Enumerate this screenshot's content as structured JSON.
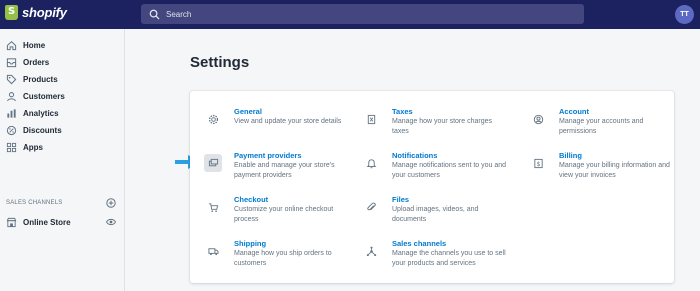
{
  "topbar": {
    "brand": "shopify",
    "search_placeholder": "Search",
    "avatar_initials": "TT"
  },
  "sidebar": {
    "items": [
      {
        "label": "Home",
        "icon": "home-icon"
      },
      {
        "label": "Orders",
        "icon": "orders-icon"
      },
      {
        "label": "Products",
        "icon": "tag-icon"
      },
      {
        "label": "Customers",
        "icon": "person-icon"
      },
      {
        "label": "Analytics",
        "icon": "bar-chart-icon"
      },
      {
        "label": "Discounts",
        "icon": "discount-icon"
      },
      {
        "label": "Apps",
        "icon": "apps-icon"
      }
    ],
    "sales_channels_label": "SALES CHANNELS",
    "online_store_label": "Online Store"
  },
  "main": {
    "title": "Settings",
    "settings": [
      {
        "title": "General",
        "desc": "View and update your store details",
        "icon": "gear-icon"
      },
      {
        "title": "Taxes",
        "desc": "Manage how your store charges taxes",
        "icon": "receipt-icon"
      },
      {
        "title": "Account",
        "desc": "Manage your accounts and permissions",
        "icon": "account-icon"
      },
      {
        "title": "Payment providers",
        "desc": "Enable and manage your store's payment providers",
        "icon": "payment-icon"
      },
      {
        "title": "Notifications",
        "desc": "Manage notifications sent to you and your customers",
        "icon": "bell-icon"
      },
      {
        "title": "Billing",
        "desc": "Manage your billing information and view your invoices",
        "icon": "billing-icon"
      },
      {
        "title": "Checkout",
        "desc": "Customize your online checkout process",
        "icon": "cart-icon"
      },
      {
        "title": "Files",
        "desc": "Upload images, videos, and documents",
        "icon": "paperclip-icon"
      },
      {
        "title": "Shipping",
        "desc": "Manage how you ship orders to customers",
        "icon": "truck-icon"
      },
      {
        "title": "Sales channels",
        "desc": "Manage the channels you use to sell your products and services",
        "icon": "channels-icon"
      }
    ]
  },
  "colors": {
    "topbar": "#1c2260",
    "link": "#007ace",
    "arrow": "#2c9fe0",
    "logo": "#95bf47"
  }
}
